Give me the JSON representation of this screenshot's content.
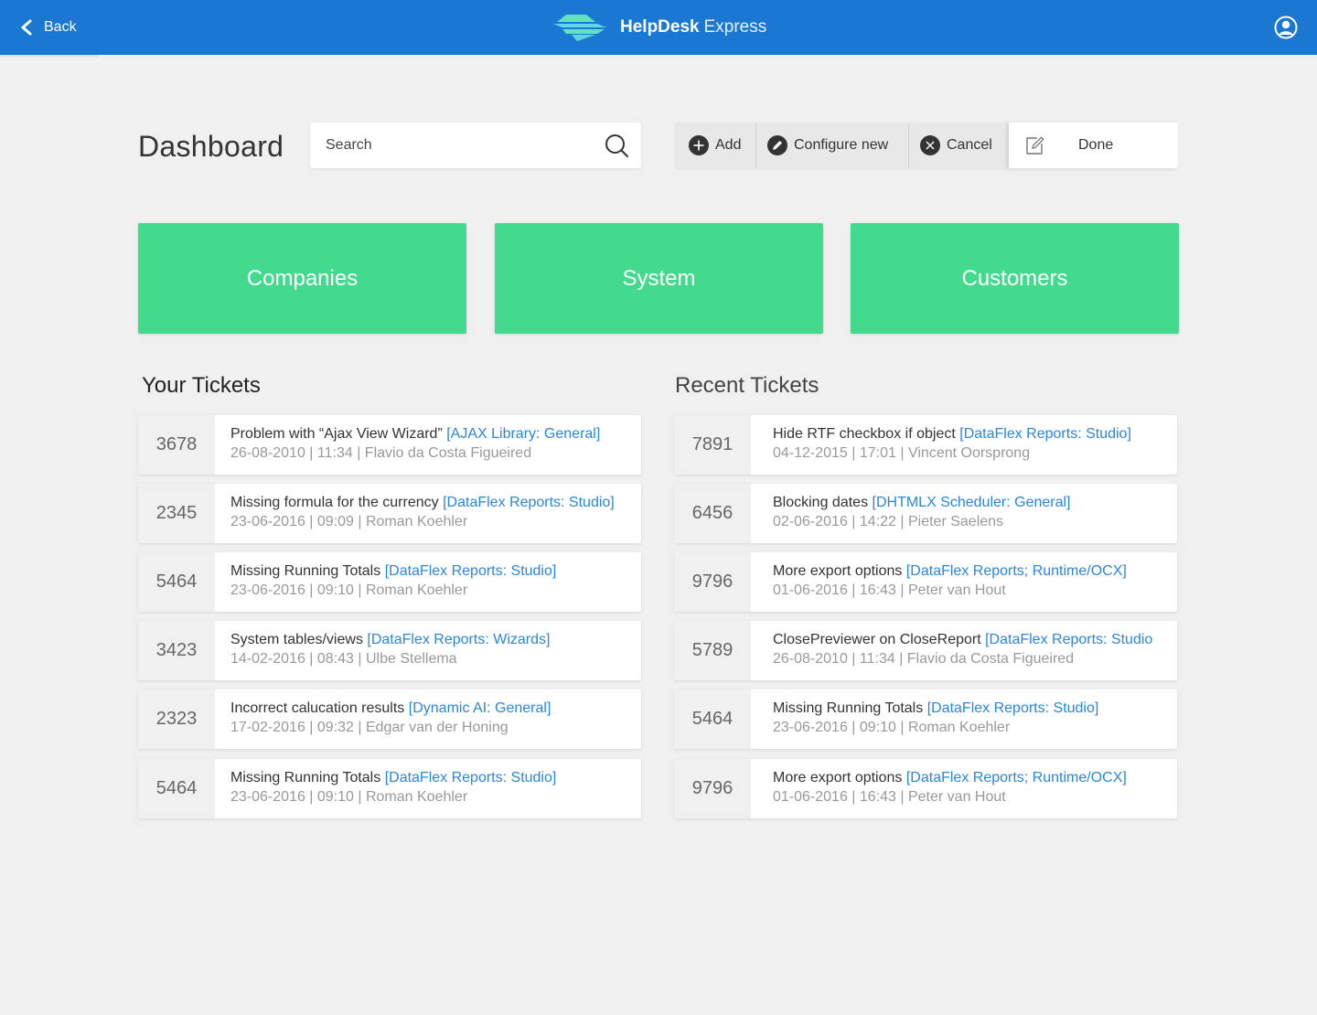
{
  "header": {
    "back_label": "Back",
    "brand_name": "HelpDesk",
    "brand_sub": "Express",
    "bar_color": "#1a78d2"
  },
  "page_title": "Dashboard",
  "search": {
    "placeholder": "Search"
  },
  "toolbar": {
    "add_label": "Add",
    "configure_label": "Configure new",
    "cancel_label": "Cancel",
    "done_label": "Done"
  },
  "tiles": [
    {
      "label": "Companies"
    },
    {
      "label": "System"
    },
    {
      "label": "Customers"
    }
  ],
  "tile_color": "#44da8e",
  "your_tickets": {
    "title": "Your Tickets",
    "items": [
      {
        "id": "3678",
        "subject": "Problem with “Ajax View Wizard”",
        "tag": "[AJAX Library: General]",
        "meta": "26-08-2010 | 11:34 | Flavio da Costa Figueired"
      },
      {
        "id": "2345",
        "subject": "Missing formula for the currency",
        "tag": "[DataFlex Reports: Studio]",
        "meta": "23-06-2016 | 09:09 | Roman Koehler"
      },
      {
        "id": "5464",
        "subject": "Missing Running Totals",
        "tag": "[DataFlex Reports: Studio]",
        "meta": "23-06-2016 | 09:10 | Roman Koehler"
      },
      {
        "id": "3423",
        "subject": "System tables/views ",
        "tag": "[DataFlex Reports: Wizards]",
        "meta": "14-02-2016 | 08:43 | Ulbe Stellema"
      },
      {
        "id": "2323",
        "subject": "Incorrect calucation results",
        "tag": "[Dynamic AI: General]",
        "meta": "17-02-2016 | 09:32 | Edgar van der Honing"
      },
      {
        "id": "5464",
        "subject": "Missing Running Totals",
        "tag": "[DataFlex Reports: Studio]",
        "meta": "23-06-2016 | 09:10 | Roman Koehler"
      }
    ]
  },
  "recent_tickets": {
    "title": "Recent Tickets",
    "items": [
      {
        "id": "7891",
        "subject": "Hide RTF checkbox if object",
        "tag": "[DataFlex Reports: Studio]",
        "meta": "04-12-2015 | 17:01 | Vincent Oorsprong"
      },
      {
        "id": "6456",
        "subject": "Blocking dates",
        "tag": "[DHTMLX Scheduler: General]",
        "meta": "02-06-2016 | 14:22 | Pieter Saelens"
      },
      {
        "id": "9796",
        "subject": "More export options",
        "tag": "[DataFlex Reports; Runtime/OCX]",
        "meta": "01-06-2016 | 16:43 | Peter van Hout"
      },
      {
        "id": "5789",
        "subject": "ClosePreviewer on CloseReport ",
        "tag": "[DataFlex Reports: Studio",
        "meta": "26-08-2010 | 11:34 | Flavio da Costa Figueired"
      },
      {
        "id": "5464",
        "subject": "Missing Running Totals",
        "tag": "[DataFlex Reports: Studio]",
        "meta": "23-06-2016 | 09:10 | Roman Koehler"
      },
      {
        "id": "9796",
        "subject": "More export options",
        "tag": "[DataFlex Reports; Runtime/OCX]",
        "meta": "01-06-2016 | 16:43 | Peter van Hout"
      }
    ]
  }
}
